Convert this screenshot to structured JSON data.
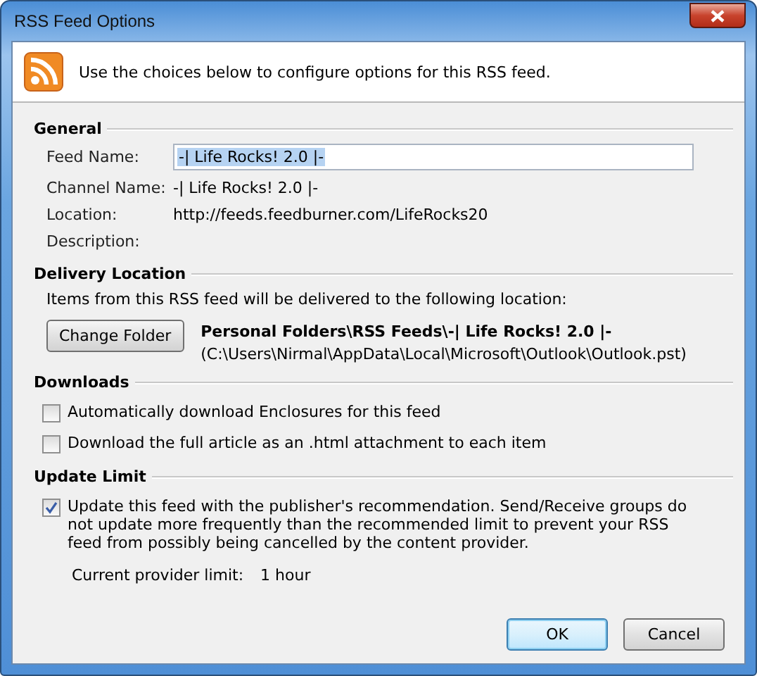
{
  "window": {
    "title": "RSS Feed Options"
  },
  "header": {
    "text": "Use the choices below to configure options for this RSS feed."
  },
  "general": {
    "title": "General",
    "fields": [
      {
        "kind": "input",
        "label": "Feed Name:",
        "value": "-| Life Rocks! 2.0 |-",
        "text_selected": true
      },
      {
        "kind": "text",
        "label": "Channel Name:",
        "value": "-| Life Rocks! 2.0 |-"
      },
      {
        "kind": "text",
        "label": "Location:",
        "value": "http://feeds.feedburner.com/LifeRocks20"
      },
      {
        "kind": "text",
        "label": "Description:"
      }
    ]
  },
  "delivery": {
    "title": "Delivery Location",
    "text": "Items from this RSS feed will be delivered to the following location:",
    "button": "Change Folder",
    "folder": "Personal Folders\\RSS Feeds\\-| Life Rocks! 2.0 |-",
    "file": "(C:\\Users\\Nirmal\\AppData\\Local\\Microsoft\\Outlook\\Outlook.pst)"
  },
  "downloads": {
    "title": "Downloads",
    "options": [
      {
        "label": "Automatically download Enclosures for this feed",
        "checked": false
      },
      {
        "label": "Download the full article as an .html attachment to each item",
        "checked": false
      }
    ]
  },
  "update_limit": {
    "title": "Update Limit",
    "option": {
      "label": "Update this feed with the publisher's recommendation. Send/Receive groups do not update more frequently than the recommended limit to prevent your RSS feed from possibly being cancelled by the content provider.",
      "checked": true
    },
    "limit_label": "Current provider limit:",
    "limit_value": "1 hour"
  },
  "buttons": [
    {
      "label": "OK",
      "default": true
    },
    {
      "label": "Cancel",
      "default": false
    }
  ]
}
